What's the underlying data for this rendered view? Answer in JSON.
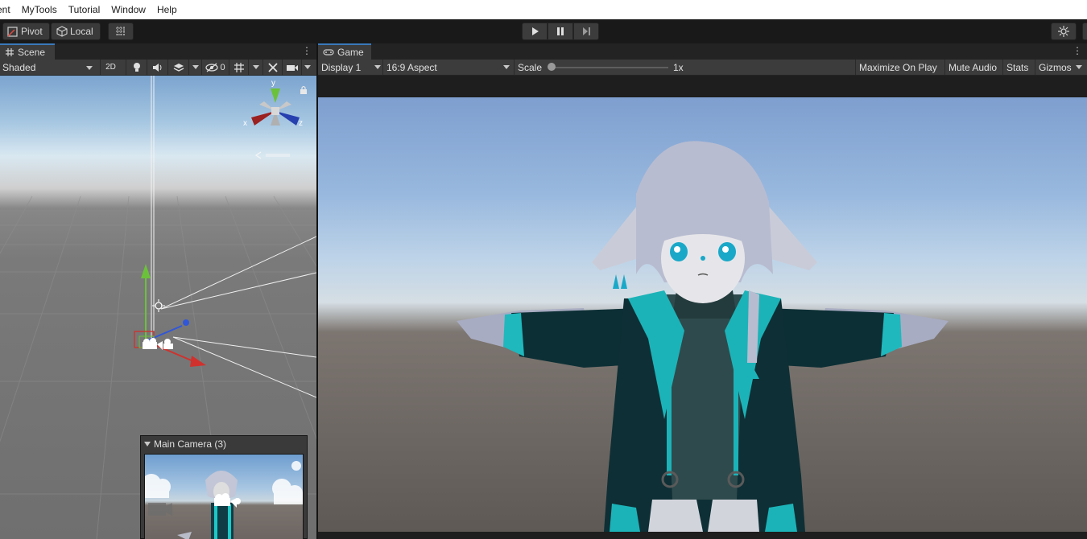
{
  "menu": {
    "items": [
      "ent",
      "MyTools",
      "Tutorial",
      "Window",
      "Help"
    ]
  },
  "toolbar": {
    "pivot_label": "Pivot",
    "local_label": "Local",
    "icons": [
      "grid-snap-icon",
      "play-icon",
      "pause-icon",
      "step-icon",
      "collab-icon"
    ]
  },
  "scene": {
    "tab_label": "Scene",
    "shading_mode": "Shaded",
    "mode_2d_label": "2D",
    "hidden_count": "0",
    "gizmo_axes": {
      "y": "y",
      "x": "x",
      "z": "z"
    }
  },
  "camera_preview": {
    "title": "Main Camera (3)"
  },
  "game": {
    "tab_label": "Game",
    "display": "Display 1",
    "aspect": "16:9 Aspect",
    "scale_label": "Scale",
    "scale_value": "1x",
    "maximize_label": "Maximize On Play",
    "mute_label": "Mute Audio",
    "stats_label": "Stats",
    "gizmos_label": "Gizmos"
  },
  "colors": {
    "accent_tab": "#3a79bb",
    "axis_x": "#d0312d",
    "axis_y": "#6cc13a",
    "axis_z": "#3157d8"
  }
}
